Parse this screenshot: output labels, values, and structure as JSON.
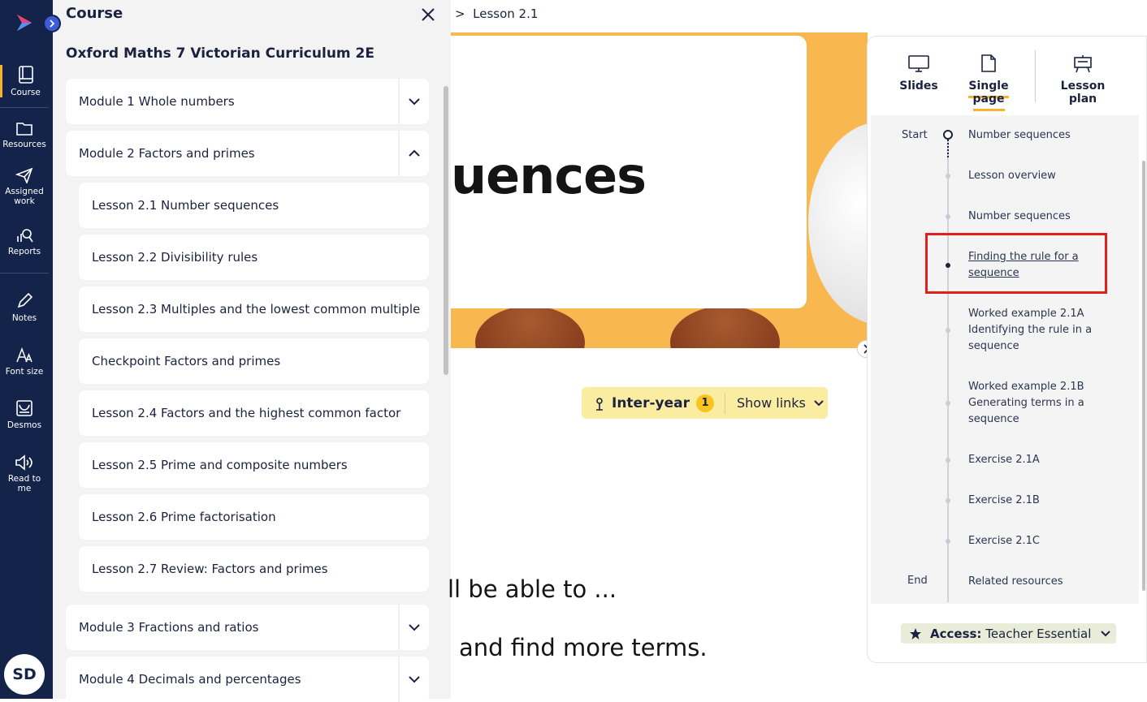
{
  "rail": {
    "items": [
      {
        "label": "Course",
        "icon": "book-icon"
      },
      {
        "label": "Resources",
        "icon": "folder-icon"
      },
      {
        "label": "Assigned",
        "label2": "work",
        "icon": "send-icon"
      },
      {
        "label": "Reports",
        "icon": "reports-icon"
      },
      {
        "label": "Notes",
        "icon": "pencil-icon"
      },
      {
        "label": "Font size",
        "icon": "font-size-icon"
      },
      {
        "label": "Desmos",
        "icon": "desmos-icon"
      },
      {
        "label": "Read to me",
        "icon": "speaker-icon"
      }
    ],
    "avatar": "SD",
    "accent": "#f7b32b"
  },
  "panel": {
    "title": "Course",
    "course_name": "Oxford Maths 7 Victorian Curriculum 2E",
    "modules_top": [
      {
        "label": "Module 1 Whole numbers",
        "expanded": false
      },
      {
        "label": "Module 2 Factors and primes",
        "expanded": true
      }
    ],
    "lessons": [
      "Lesson 2.1 Number sequences",
      "Lesson 2.2 Divisibility rules",
      "Lesson 2.3 Multiples and the lowest common multiple",
      "Checkpoint Factors and primes",
      "Lesson 2.4 Factors and the highest common factor",
      "Lesson 2.5 Prime and composite numbers",
      "Lesson 2.6 Prime factorisation",
      "Lesson 2.7 Review: Factors and primes"
    ],
    "modules_bottom": [
      {
        "label": "Module 3 Fractions and ratios",
        "expanded": false
      },
      {
        "label": "Module 4 Decimals and percentages",
        "expanded": false
      }
    ]
  },
  "breadcrumb": {
    "sep": ">",
    "current": "Lesson 2.1"
  },
  "main": {
    "hero_title": "uences",
    "link_chip": {
      "label": "Inter-year",
      "count": "1",
      "action": "Show links"
    },
    "line1": "ll be able to ...",
    "line2": "and find more terms."
  },
  "right": {
    "tabs": [
      {
        "label": "Slides",
        "icon": "monitor-icon"
      },
      {
        "label": "Single page",
        "icon": "page-icon",
        "active": true
      },
      {
        "label": "Lesson plan",
        "icon": "easel-icon"
      }
    ],
    "toc_start": "Start",
    "toc_end": "End",
    "toc": [
      "Number sequences",
      "Lesson overview",
      "Number sequences",
      "Finding the rule for a sequence",
      "Worked example 2.1A Identifying the rule in a sequence",
      "Worked example 2.1B Generating terms in a sequence",
      "Exercise 2.1A",
      "Exercise 2.1B",
      "Exercise 2.1C",
      "Related resources"
    ],
    "access_label": "Access:",
    "access_value": "Teacher Essential"
  }
}
